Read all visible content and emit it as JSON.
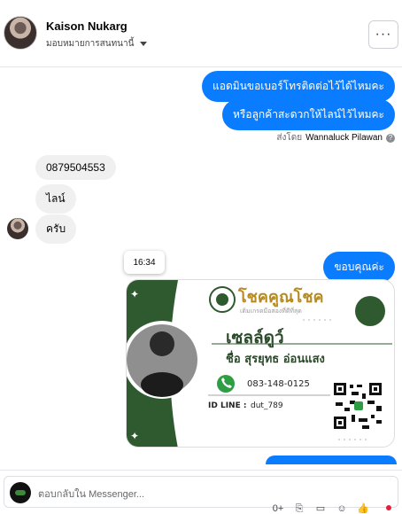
{
  "header": {
    "name": "Kaison Nukarg",
    "assign_label": "มอบหมายการสนทนานี้",
    "more_glyph": "···"
  },
  "messages": {
    "outgoing_1": "แอดมินขอเบอร์โทรติดต่อไว้ได้ไหมคะ",
    "outgoing_2": "หรือลูกค้าสะดวกให้ไลน์ไว้ไหมคะ",
    "sent_by_prefix": "ส่งโดย",
    "sent_by_name": "Wannaluck Pilawan",
    "incoming_1": "0879504553",
    "incoming_2": "ไลน์",
    "incoming_3": "ครับ",
    "timestamp": "16:34",
    "outgoing_3": "ขอบคุณค่ะ"
  },
  "card": {
    "brand": "โชคคูณโชค",
    "tagline": "เติมเกรดมือสองที่ดีที่สุด",
    "nickname": "เซลล์ดูว์",
    "fullname": "ชื่อ สุรยุทธ อ่อนแสง",
    "phone": "083-148-0125",
    "idline_label": "ID LINE :",
    "idline_value": "dut_789",
    "colors": {
      "green": "#2f5a2f",
      "gold": "#b78a1f"
    }
  },
  "composer": {
    "placeholder": "ตอบกลับใน Messenger...",
    "tools": [
      "emoji-plus",
      "attach-icon",
      "saved-reply-icon",
      "smile-icon",
      "like-icon"
    ]
  }
}
